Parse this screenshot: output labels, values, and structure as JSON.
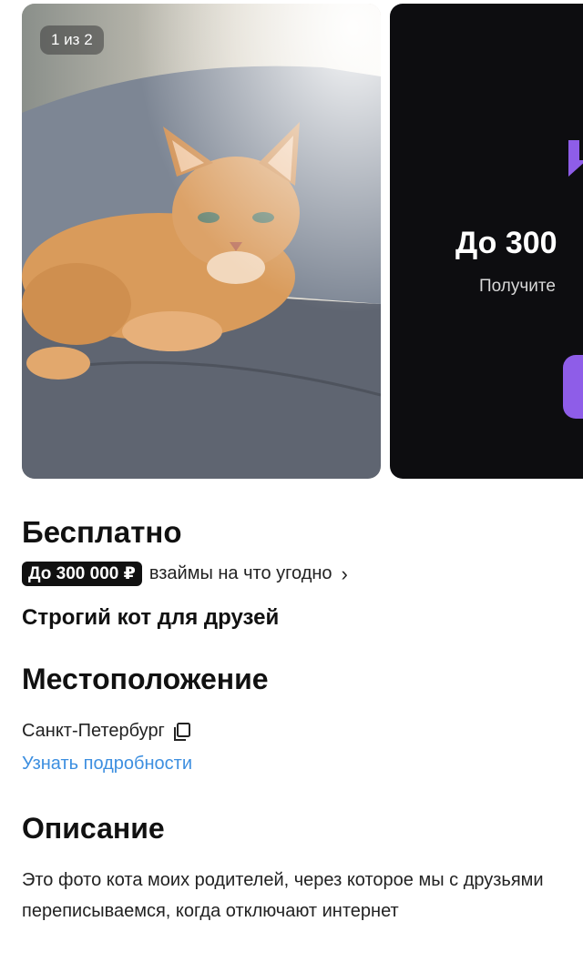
{
  "gallery": {
    "counter": "1 из 2"
  },
  "ad": {
    "title": "До 300",
    "subtitle": "Получите",
    "accent_color": "#8e5de8"
  },
  "listing": {
    "price": "Бесплатно",
    "loan_badge": "До 300 000 ₽",
    "loan_text": "взаймы на что угодно",
    "title": "Строгий кот для друзей"
  },
  "location": {
    "heading": "Местоположение",
    "city": "Санкт-Петербург",
    "details_link": "Узнать подробности",
    "link_color": "#3d8fe0"
  },
  "description": {
    "heading": "Описание",
    "text": "Это фото кота моих родителей, через которое мы с друзьями переписываемся, когда отключают интернет"
  }
}
